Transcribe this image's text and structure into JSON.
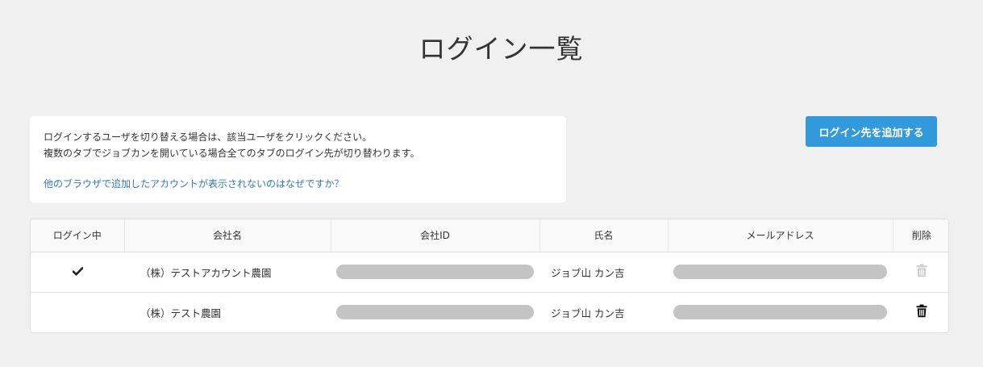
{
  "page": {
    "title": "ログイン一覧"
  },
  "info": {
    "line1": "ログインするユーザを切り替える場合は、該当ユーザをクリックください。",
    "line2": "複数のタブでジョブカンを開いている場合全てのタブのログイン先が切り替わります。",
    "help_link": "他のブラウザで追加したアカウントが表示されないのはなぜですか？"
  },
  "toolbar": {
    "add_label": "ログイン先を追加する"
  },
  "table": {
    "headers": {
      "logged_in": "ログイン中",
      "company_name": "会社名",
      "company_id": "会社ID",
      "person_name": "氏名",
      "email": "メールアドレス",
      "delete": "削除"
    },
    "rows": [
      {
        "logged_in": true,
        "company_name": "（株）テストアカウント農園",
        "person_name": "ジョブ山 カン吉",
        "delete_enabled": false
      },
      {
        "logged_in": false,
        "company_name": "（株）テスト農園",
        "person_name": "ジョブ山 カン吉",
        "delete_enabled": true
      }
    ]
  },
  "colors": {
    "background": "#f0f0f0",
    "accent_button": "#3399dd",
    "link": "#337ab7",
    "mask": "#c4c4c4",
    "trash_disabled": "#cccccc",
    "trash_enabled": "#111111"
  },
  "icons": {
    "current_login": "check-icon",
    "delete": "trash-icon"
  }
}
